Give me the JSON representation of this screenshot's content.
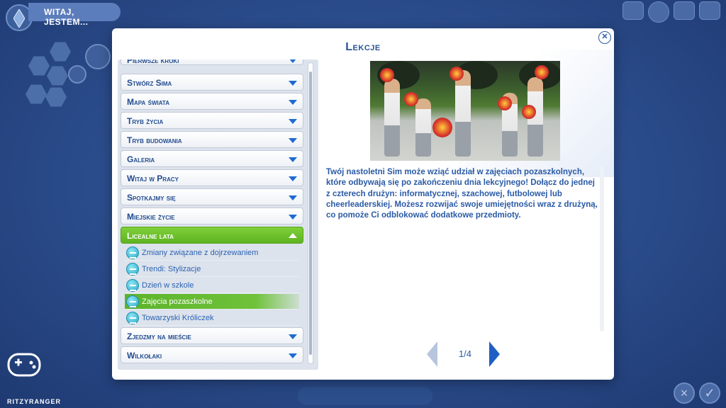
{
  "hud": {
    "title": "WITAJ, JESTEM...",
    "watermark": "RITZYRANGER"
  },
  "dialog": {
    "title": "Lekcje",
    "close_icon": "close-icon",
    "categories_top": [
      {
        "label": "Pierwsze kroki",
        "partial": true
      },
      {
        "label": "Stwórz Sima"
      },
      {
        "label": "Mapa świata"
      },
      {
        "label": "Tryb życia"
      },
      {
        "label": "Tryb budowania"
      },
      {
        "label": "Galeria"
      },
      {
        "label": "Witaj w Pracy"
      },
      {
        "label": "Spotkajmy się"
      },
      {
        "label": "Miejskie życie"
      }
    ],
    "active_category": {
      "label": "Licealne lata",
      "expanded": true
    },
    "lessons": [
      {
        "label": "Zmiany związane z dojrzewaniem",
        "selected": false
      },
      {
        "label": "Trendi: Stylizacje",
        "selected": false
      },
      {
        "label": "Dzień w szkole",
        "selected": false
      },
      {
        "label": "Zajęcia pozaszkolne",
        "selected": true
      },
      {
        "label": "Towarzyski Króliczek",
        "selected": false
      }
    ],
    "categories_bottom": [
      {
        "label": "Zjedzmy na mieście"
      },
      {
        "label": "Wilkołaki"
      }
    ],
    "description": "Twój nastoletni Sim może wziąć udział w zajęciach pozaszkolnych, które odbywają się po zakończeniu dnia lekcyjnego! Dołącz do jednej z czterech drużyn: informatycznej, szachowej, futbolowej lub cheerleaderskiej. Możesz rozwijać swoje umiejętności wraz z drużyną, co pomoże Ci odblokować dodatkowe przedmioty.",
    "pager": {
      "label": "1/4",
      "current": 1,
      "total": 4
    }
  },
  "colors": {
    "accent_blue": "#27539b",
    "active_green": "#6fc23a",
    "background": "#2b4a86"
  }
}
